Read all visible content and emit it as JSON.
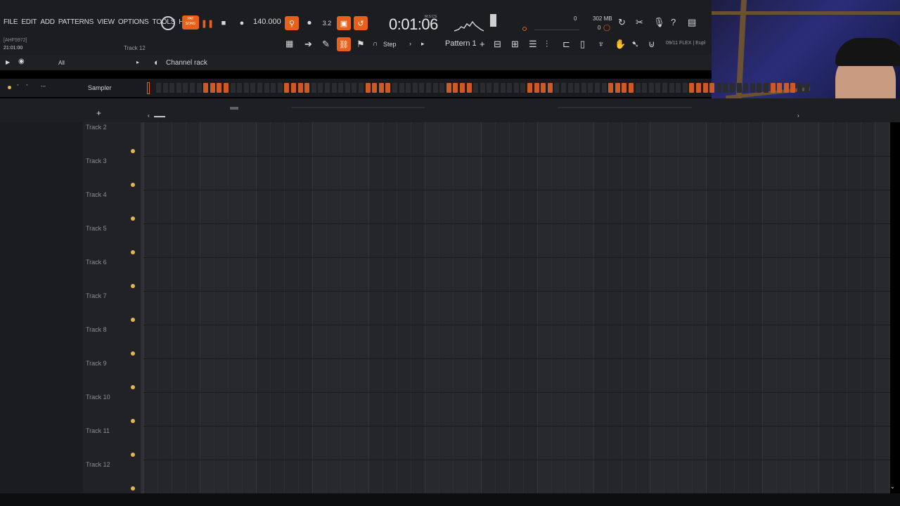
{
  "menu": [
    "FILE",
    "EDIT",
    "ADD",
    "PATTERNS",
    "VIEW",
    "OPTIONS",
    "TOOLS",
    "HELP"
  ],
  "hint": {
    "line1": "[AHF5972]",
    "line2": "21:01:00",
    "track": "Track 12"
  },
  "transport": {
    "pat_song": "PAT SONG",
    "tempo": "140.000",
    "timer": "0:01:06",
    "timer_unit": "M:S:CS",
    "cpu": "0",
    "memory": "302 MB",
    "poly": "0",
    "snap": "Step",
    "pattern": "Pattern 1",
    "browser": "09/11  FLEX | Eupl"
  },
  "channel_rack": {
    "filter": "All",
    "title": "Channel rack",
    "channel": "Sampler",
    "channel_hint": "---"
  },
  "steps": [
    0,
    0,
    0,
    0,
    0,
    0,
    0,
    1,
    1,
    1,
    1,
    0,
    0,
    0,
    0,
    0,
    0,
    0,
    0,
    1,
    1,
    1,
    1,
    0,
    0,
    0,
    0,
    0,
    0,
    0,
    0,
    1,
    1,
    1,
    1,
    0,
    0,
    0,
    0,
    0,
    0,
    0,
    0,
    1,
    1,
    1,
    1,
    0,
    0,
    0,
    0,
    0,
    0,
    0,
    0,
    1,
    1,
    1,
    1,
    0,
    0,
    0,
    0,
    0,
    0,
    0,
    0,
    1,
    1,
    1,
    1,
    0,
    0,
    0,
    0,
    0,
    0,
    0,
    0,
    1,
    1,
    1,
    1,
    0,
    0,
    0,
    0,
    0,
    0,
    0,
    0,
    1,
    1,
    1,
    1,
    0,
    0
  ],
  "tracks": [
    "Track 2",
    "Track 3",
    "Track 4",
    "Track 5",
    "Track 6",
    "Track 7",
    "Track 8",
    "Track 9",
    "Track 10",
    "Track 11",
    "Track 12"
  ],
  "colors": {
    "accent": "#e8611a",
    "step_on": "#cc5a22",
    "dot": "#e7b64a"
  }
}
